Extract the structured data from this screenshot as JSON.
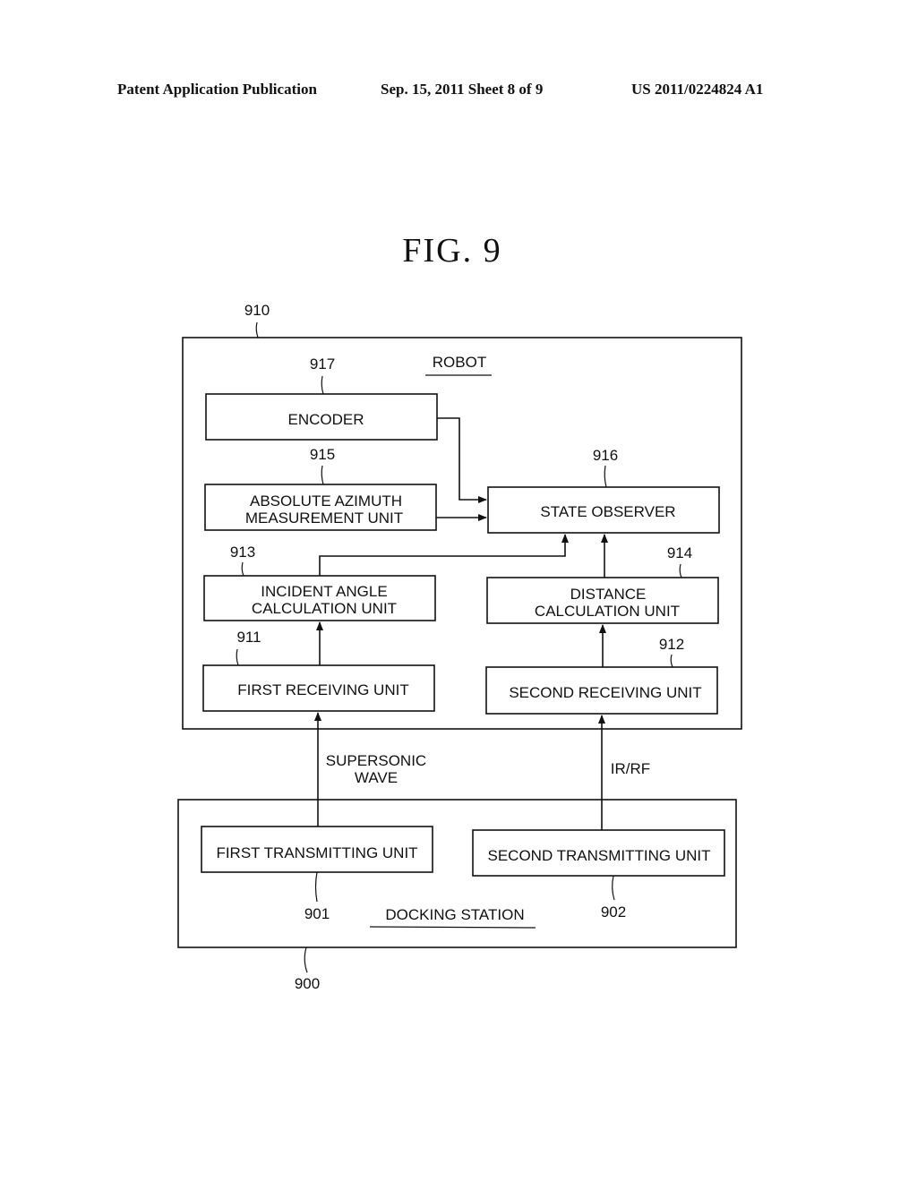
{
  "header": {
    "publication": "Patent Application Publication",
    "date_sheet": "Sep. 15, 2011   Sheet 8 of 9",
    "patent_number": "US 2011/0224824 A1"
  },
  "figure": {
    "title": "FIG.  9"
  },
  "robot": {
    "ref": "910",
    "label": "ROBOT",
    "blocks": {
      "encoder": {
        "ref": "917",
        "lines": [
          "ENCODER"
        ]
      },
      "azimuth": {
        "ref": "915",
        "lines": [
          "ABSOLUTE AZIMUTH",
          "MEASUREMENT UNIT"
        ]
      },
      "state_observer": {
        "ref": "916",
        "lines": [
          "STATE OBSERVER"
        ]
      },
      "incident_angle": {
        "ref": "913",
        "lines": [
          "INCIDENT ANGLE",
          "CALCULATION UNIT"
        ]
      },
      "distance": {
        "ref": "914",
        "lines": [
          "DISTANCE",
          "CALCULATION UNIT"
        ]
      },
      "first_receiving": {
        "ref": "911",
        "lines": [
          "FIRST RECEIVING UNIT"
        ]
      },
      "second_receiving": {
        "ref": "912",
        "lines": [
          "SECOND RECEIVING UNIT"
        ]
      }
    }
  },
  "signals": {
    "supersonic": [
      "SUPERSONIC",
      "WAVE"
    ],
    "irrf": "IR/RF"
  },
  "docking_station": {
    "ref": "900",
    "label": "DOCKING STATION",
    "blocks": {
      "first_transmitting": {
        "ref": "901",
        "lines": [
          "FIRST TRANSMITTING UNIT"
        ]
      },
      "second_transmitting": {
        "ref": "902",
        "lines": [
          "SECOND TRANSMITTING UNIT"
        ]
      }
    }
  }
}
